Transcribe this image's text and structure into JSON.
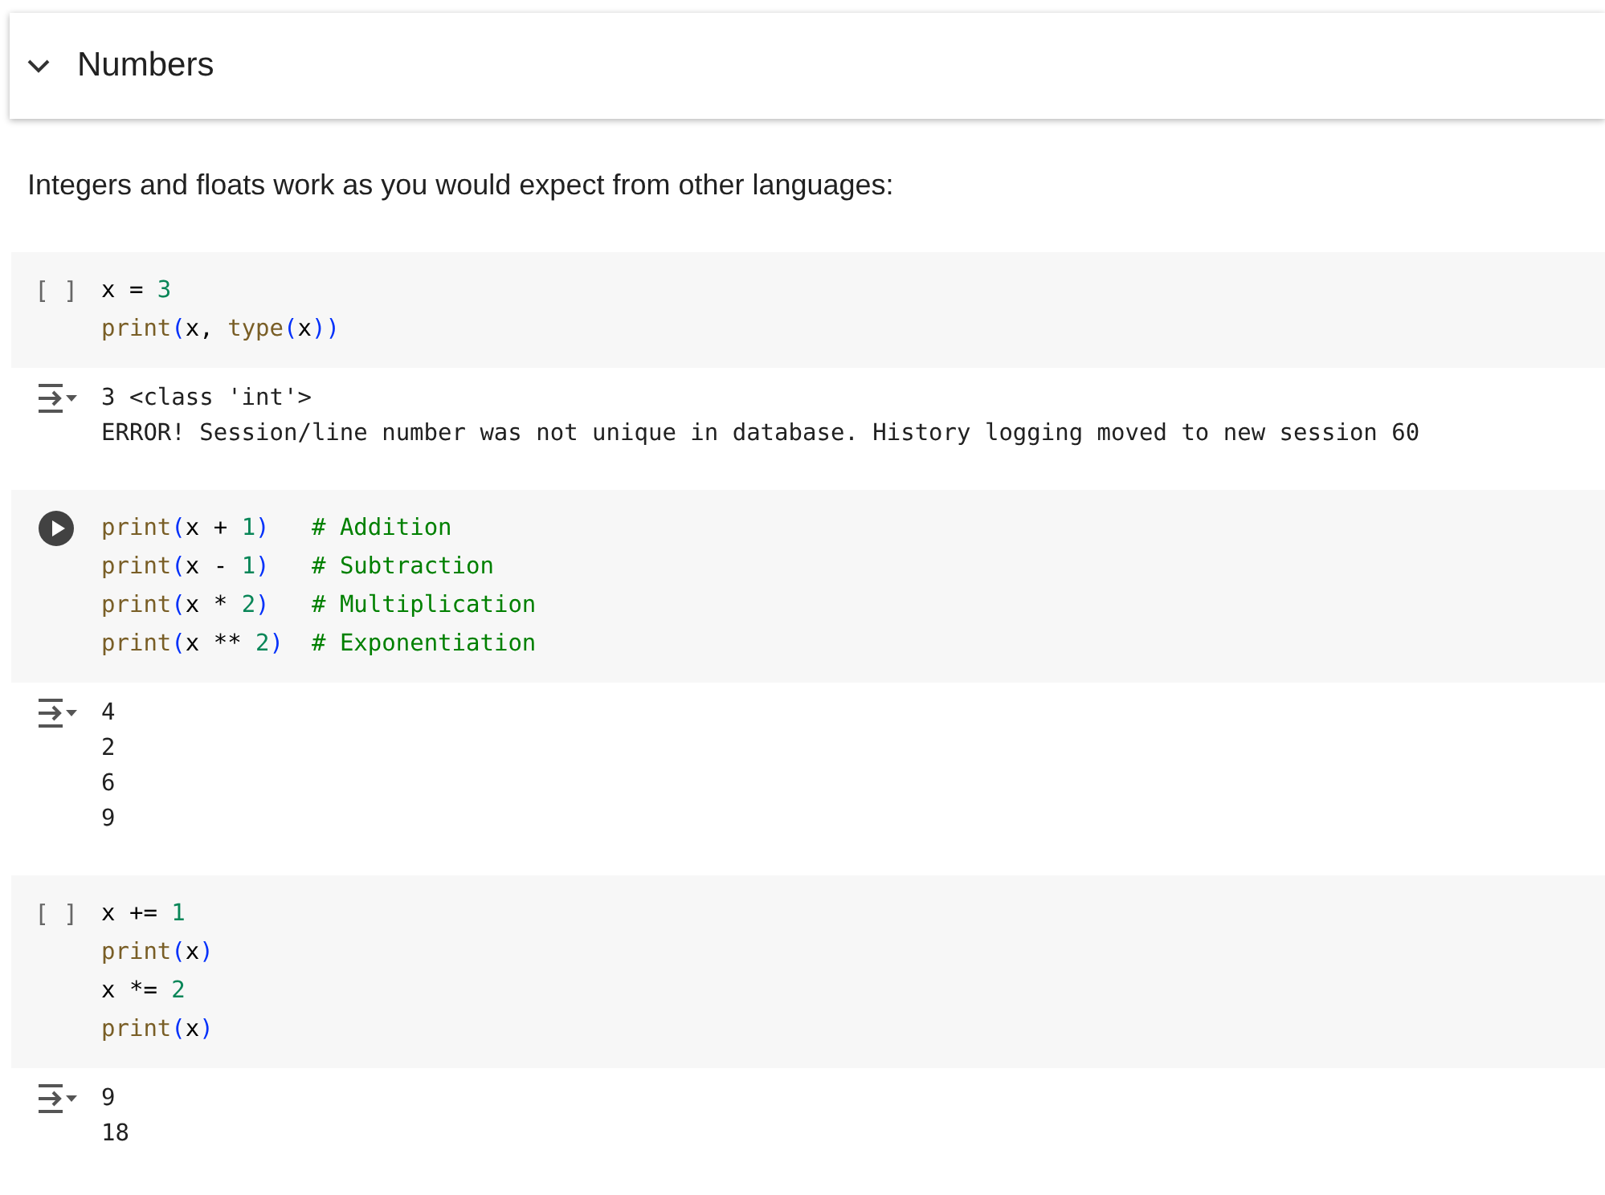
{
  "section": {
    "title": "Numbers",
    "expanded": true
  },
  "text": "Integers and floats work as you would expect from other languages:",
  "cells": [
    {
      "prompt": "[ ]",
      "focused": false,
      "code": [
        "x = 3",
        "print(x, type(x))"
      ],
      "output": [
        "3 <class 'int'>",
        "ERROR! Session/line number was not unique in database. History logging moved to new session 60"
      ]
    },
    {
      "focused": true,
      "code": [
        "print(x + 1)   # Addition",
        "print(x - 1)   # Subtraction",
        "print(x * 2)   # Multiplication",
        "print(x ** 2)  # Exponentiation"
      ],
      "output": [
        "4",
        "2",
        "6",
        "9"
      ]
    },
    {
      "prompt": "[ ]",
      "focused": false,
      "code": [
        "x += 1",
        "print(x)",
        "x *= 2",
        "print(x)"
      ],
      "output": [
        "9",
        "18"
      ]
    }
  ]
}
